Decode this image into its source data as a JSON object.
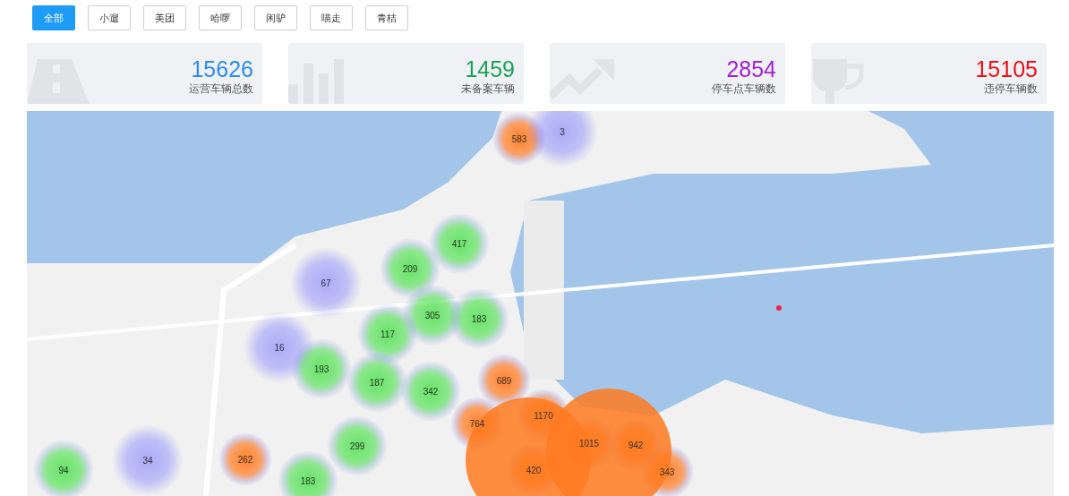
{
  "tabs": [
    {
      "label": "全部",
      "selected": true
    },
    {
      "label": "小遛",
      "selected": false
    },
    {
      "label": "美团",
      "selected": false
    },
    {
      "label": "哈啰",
      "selected": false
    },
    {
      "label": "闲驴",
      "selected": false
    },
    {
      "label": "喵走",
      "selected": false
    },
    {
      "label": "青桔",
      "selected": false
    }
  ],
  "stats": [
    {
      "kind": "road",
      "value": "15626",
      "label": "运营车辆总数",
      "color": "#2b8cf0"
    },
    {
      "kind": "bars",
      "value": "1459",
      "label": "未备案车辆",
      "color": "#1aa35a"
    },
    {
      "kind": "trend",
      "value": "2854",
      "label": "停车点车辆数",
      "color": "#a020d8"
    },
    {
      "kind": "trophy",
      "value": "15105",
      "label": "违停车辆数",
      "color": "#e8101a"
    }
  ],
  "map": {
    "clusters": [
      "583",
      "3",
      "417",
      "209",
      "67",
      "305",
      "183",
      "117",
      "16",
      "193",
      "187",
      "342",
      "689",
      "764",
      "1170",
      "1015",
      "942",
      "420",
      "343",
      "299",
      "262",
      "183",
      "94",
      "34"
    ]
  }
}
